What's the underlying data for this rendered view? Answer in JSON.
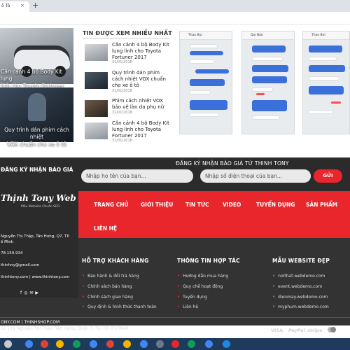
{
  "browser": {
    "tab_title": "ỗ Tô",
    "close_glyph": "×",
    "new_tab_glyph": "+"
  },
  "featured": [
    {
      "caption_line1": "Cần cảnh 4 bộ Body Kit lung",
      "caption_line2": "linh cho Toyota Fortuner 2017"
    },
    {
      "caption_line1": "Quy trình dán phim cách nhiệt",
      "caption_line2": "VOX chuẩn cho xe ô tô"
    }
  ],
  "most_viewed": {
    "heading": "TIN ĐƯỢC XEM NHIỀU NHẤT",
    "items": [
      {
        "title": "Cần cảnh 4 bộ Body Kit lung linh cho Toyota Fortuner 2017",
        "date": "31/01/2018"
      },
      {
        "title": "Quy trình dán phim cách nhiệt VOX chuẩn cho xe ô tô",
        "date": "31/01/2018"
      },
      {
        "title": "Phim cách nhiệt VOX bảo vệ làn da phụ nữ",
        "date": "31/01/2018"
      },
      {
        "title": "Cần cảnh 4 bộ Body Kit lung linh cho Toyota Fortuner 2017",
        "date": "31/01/2018"
      }
    ]
  },
  "phones": [
    {
      "name": "Thao Bùi"
    },
    {
      "name": "Quí Bảo"
    },
    {
      "name": "Thao Bùi"
    }
  ],
  "subscribe": {
    "left_label": "ĐĂNG KÝ NHẬN BÁO GIÁ",
    "title": "ĐĂNG KÝ NHẬN BÁO GIÁ TỪ THINH TONY",
    "name_placeholder": "Nhập họ tên của bạn...",
    "phone_placeholder": "Nhập số điện thoại của bạn...",
    "send_label": "GỬI"
  },
  "brand": {
    "logo": "Thịnh Tony Web",
    "tagline": "Mẫu Website Chuẩn SEO",
    "address_line1": "Nguyễn Thị Thập, Tân Hưng, Q7, TP.",
    "address_line2": "ồ Minh",
    "phone": "78.150.934",
    "email": "thinhny@gmail.com",
    "website": "thinhtony.com | www.thinhtony.com",
    "social_icons": [
      "facebook-icon",
      "instagram-icon",
      "email-icon",
      "youtube-icon"
    ]
  },
  "nav": {
    "items": [
      "TRANG CHỦ",
      "GIỚI THIỆU",
      "TIN TỨC",
      "VIDEO",
      "TUYỂN DỤNG",
      "SẢN PHẨM",
      "LIÊN HỆ"
    ]
  },
  "columns": [
    {
      "title": "HỖ TRỢ KHÁCH HÀNG",
      "links": [
        "Bảo hành & đổi trả hàng",
        "Chính sách bán hàng",
        "Chính sách giao hàng",
        "Quy định & hình thức thanh toán"
      ]
    },
    {
      "title": "THÔNG TIN HỢP TÁC",
      "links": [
        "Hướng dẫn mua hàng",
        "Quy chế hoạt động",
        "Tuyển dụng",
        "Liên hệ"
      ]
    },
    {
      "title": "MẪU WEBSITE ĐẸP",
      "links": [
        "noithat.webdemo.com",
        "event.webdemo.com",
        "dienmay.webdemo.com",
        "myphum.webdemo.com"
      ]
    }
  ],
  "copyright": {
    "line": "ONY.COM | THINHSHOP.COM",
    "address": "Số 119 Nguyễn Thị Thập, Tân Hưng, Quận 7, Tp. Hồ Chí Minh"
  },
  "payments": [
    "VISA",
    "PayPal",
    "stripe"
  ],
  "colors": {
    "accent": "#e8262b",
    "footer_dark": "#333333",
    "taskbar": "#1f3b5c"
  }
}
